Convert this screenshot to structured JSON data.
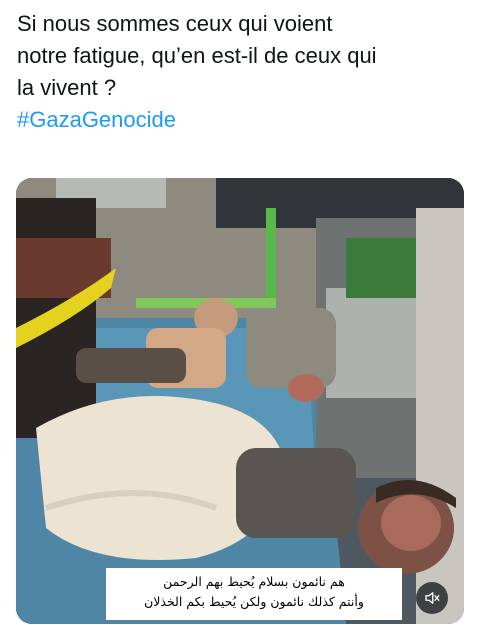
{
  "tweet": {
    "text_lines": [
      "Si nous sommes ceux qui voient",
      "notre fatigue, qu’en est-il de ceux qui",
      "la vivent ?"
    ],
    "hashtag": "#GazaGenocide"
  },
  "video": {
    "subtitles": [
      "هم نائمون بسلام يُحيط بهم الرحمن",
      "وأنتم كذلك نائمون ولكن يُحيط بكم الخذلان"
    ],
    "mute_icon": "volume-muted-icon"
  },
  "colors": {
    "hashtag": "#1d9bf0",
    "text": "#0f1419"
  }
}
